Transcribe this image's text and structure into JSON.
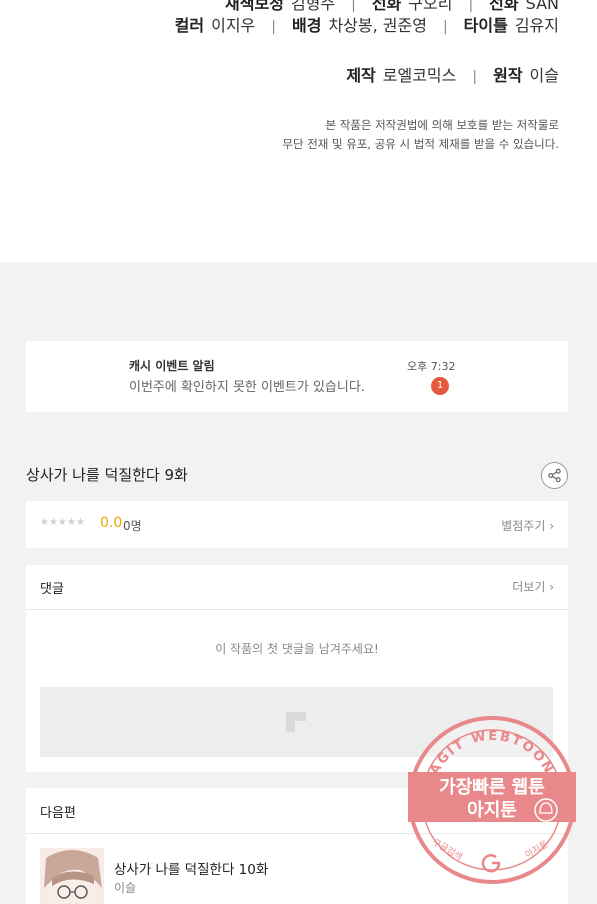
{
  "credits": {
    "row0": [
      {
        "role": "채색보정",
        "name": "김형주"
      },
      {
        "role": "선화",
        "name": "구오리"
      },
      {
        "role": "선화",
        "name": "SAN"
      }
    ],
    "row1": [
      {
        "role": "컬러",
        "name": "이지우"
      },
      {
        "role": "배경",
        "name": "차상봉, 권준영"
      },
      {
        "role": "타이틀",
        "name": "김유지"
      }
    ],
    "row2": [
      {
        "role": "제작",
        "name": "로엘코믹스"
      },
      {
        "role": "원작",
        "name": "이슬"
      }
    ],
    "separator": "|",
    "copyright_line1": "본 작품은 저작권법에 의해 보호를 받는 저작물로",
    "copyright_line2": "무단 전재 및 유포, 공유 시 법적 제재를 받을 수 있습니다."
  },
  "notification": {
    "title": "캐시 이벤트 알림",
    "text": "이번주에 확인하지 못한 이벤트가 있습니다.",
    "time": "오후 7:32",
    "badge_count": "1",
    "badge_color": "#e55a3c"
  },
  "episode": {
    "title": "상사가 나를 덕질한다 9화",
    "share_icon": "share-icon"
  },
  "rating": {
    "stars": "★★★★★",
    "score": "0.0",
    "count": "0명",
    "rate_link": "별점주기 ›",
    "score_color": "#f0a500"
  },
  "comments": {
    "header": "댓글",
    "more_link": "더보기 ›",
    "empty_text": "이 작품의 첫 댓글을 남겨주세요!"
  },
  "next": {
    "header": "다음편",
    "title": "상사가 나를 덕질한다 10화",
    "author": "이슬"
  },
  "watermark": {
    "ring_text": "AGIT WEBTOON",
    "line1": "가장빠른 웹툰",
    "line2": "아지툰",
    "bottom_left": "구글검색",
    "bottom_right": "아지툰",
    "color": "#e8888a"
  }
}
